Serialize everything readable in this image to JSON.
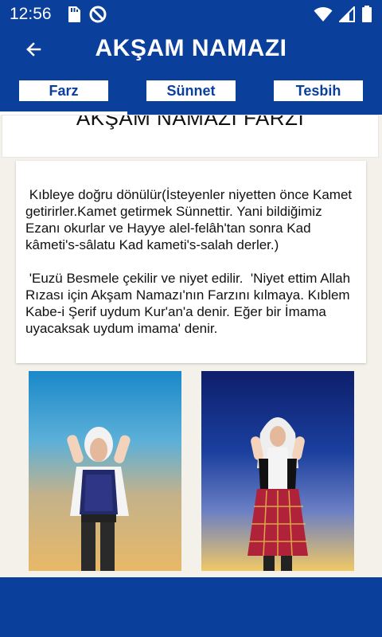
{
  "status_bar": {
    "time": "12:56",
    "left_icons": [
      "sd-card-icon",
      "no-disturb-icon"
    ],
    "right_icons": [
      "wifi-icon",
      "signal-icon",
      "battery-icon"
    ]
  },
  "app_bar": {
    "back_icon": "arrow-left-icon",
    "title": "AKŞAM NAMAZI"
  },
  "tabs": [
    {
      "label": "Farz",
      "selected": true
    },
    {
      "label": "Sünnet",
      "selected": false
    },
    {
      "label": "Tesbih",
      "selected": false
    }
  ],
  "content": {
    "section_title": "AKŞAM NAMAZI FARZI",
    "paragraphs": [
      " Kıbleye doğru dönülür(İsteyenler niyetten önce Kamet getirirler.Kamet getirmek Sünnettir. Yani bildiğimiz Ezanı okurlar ve Hayye alel-felâh'tan sonra Kad kâmeti's-sâlatu Kad kameti's-salah derler.)",
      " 'Euzü Besmele çekilir ve niyet edilir.  'Niyet ettim Allah Rızası için Akşam Namazı'nın Farzını kılmaya. Kıblem Kabe-i Şerif uydum Kur'an'a denir. Eğer bir İmama uyacaksak uydum imama' denir."
    ],
    "images": [
      "man-praying-illustration",
      "woman-praying-illustration"
    ]
  },
  "colors": {
    "primary": "#0a3f9c",
    "background": "#f4f0ea",
    "surface": "#ffffff"
  }
}
